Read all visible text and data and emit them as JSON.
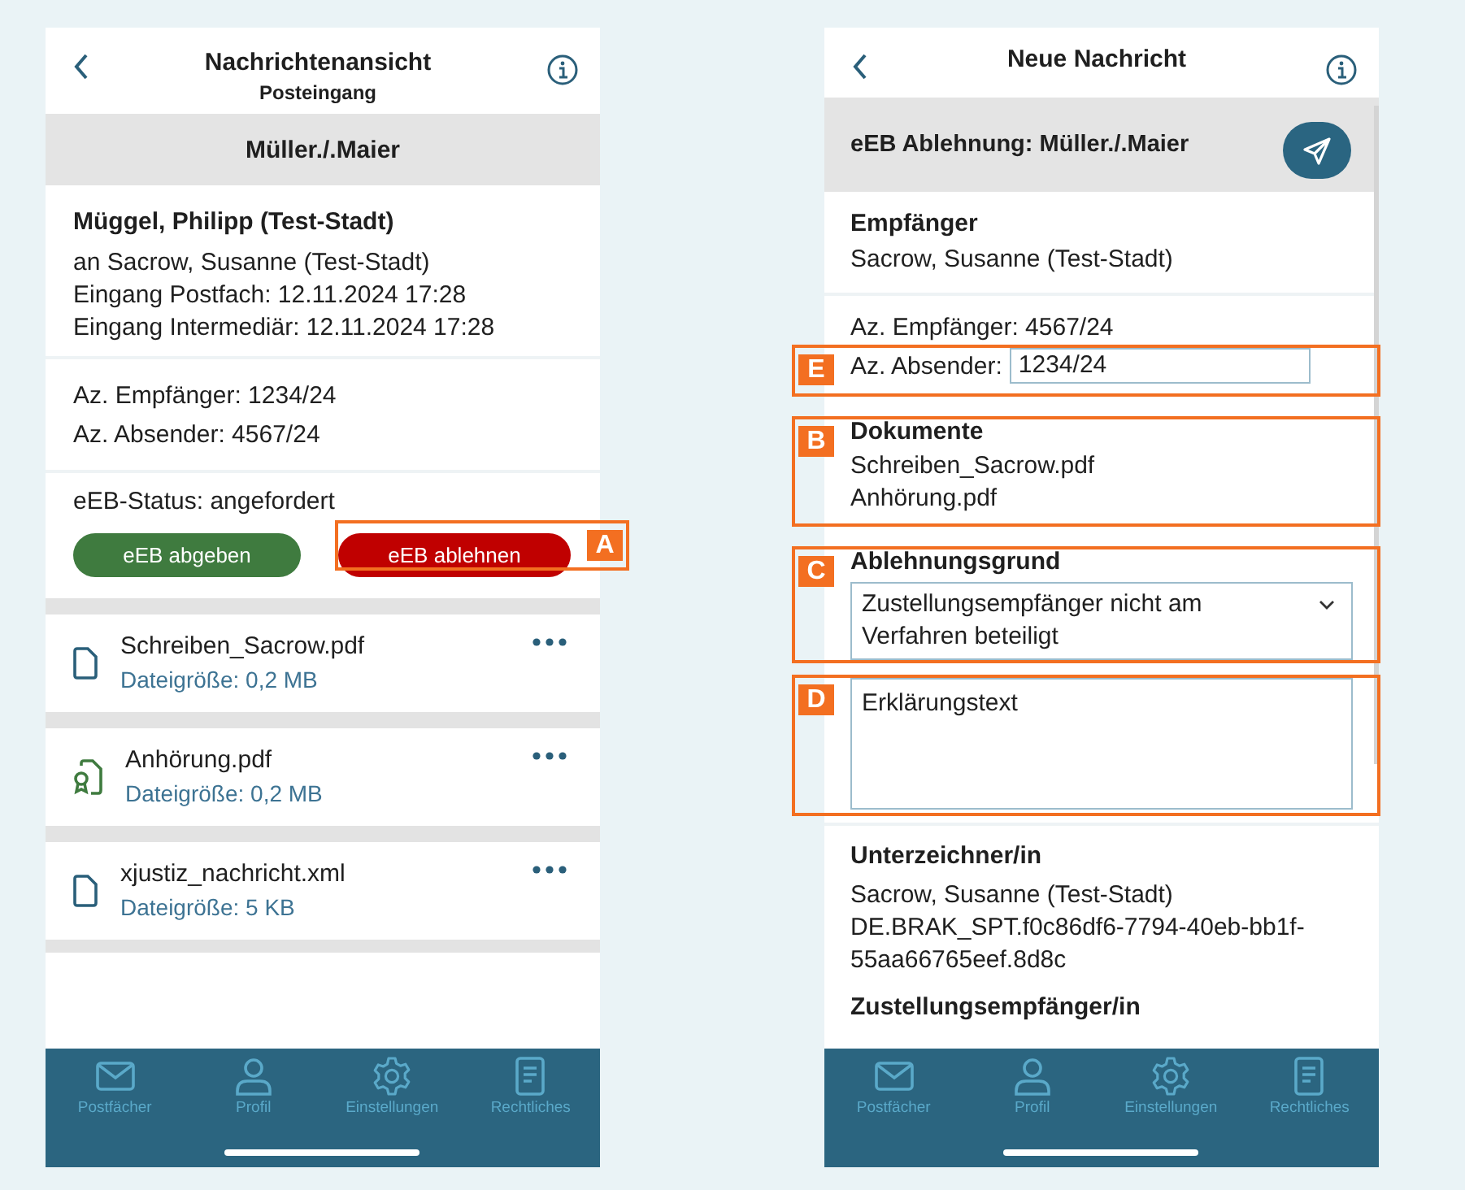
{
  "message_view": {
    "header": {
      "title": "Nachrichtenansicht",
      "subtitle": "Posteingang"
    },
    "case_title": "Müller./.Maier",
    "sender": "Müggel, Philipp (Test-Stadt)",
    "details": [
      "an Sacrow, Susanne (Test-Stadt)",
      "Eingang Postfach: 12.11.2024 17:28",
      "Eingang Intermediär: 12.11.2024 17:28"
    ],
    "references": [
      "Az. Empfänger: 1234/24",
      "Az. Absender: 4567/24"
    ],
    "status": "eEB-Status: angefordert",
    "actions": [
      {
        "label": "eEB abgeben",
        "kind": "accept"
      },
      {
        "label": "eEB ablehnen",
        "kind": "reject"
      }
    ],
    "files": [
      {
        "name": "Schreiben_Sacrow.pdf",
        "size": "Dateigröße: 0,2 MB",
        "kind": "document"
      },
      {
        "name": "Anhörung.pdf",
        "size": "Dateigröße: 0,2 MB",
        "kind": "signed"
      },
      {
        "name": "xjustiz_nachricht.xml",
        "size": "Dateigröße: 5 KB",
        "kind": "document"
      }
    ],
    "tab_bar": [
      {
        "label": "Postfächer"
      },
      {
        "label": "Profil"
      },
      {
        "label": "Einstellungen"
      },
      {
        "label": "Rechtliches"
      }
    ]
  },
  "new_message": {
    "header": {
      "title": "Neue Nachricht"
    },
    "subject": "eEB Ablehnung: Müller./.Maier",
    "recipient": {
      "label": "Empfänger",
      "value": "Sacrow, Susanne (Test-Stadt)"
    },
    "recipient_reference": "Az. Empfänger: 4567/24",
    "sender_reference": {
      "label": "Az. Absender:",
      "value": "1234/24"
    },
    "documents": {
      "label": "Dokumente",
      "items": [
        "Schreiben_Sacrow.pdf",
        "Anhörung.pdf"
      ]
    },
    "rejection_reason": {
      "label": "Ablehnungsgrund",
      "value": "Zustellungsempfänger nicht am Verfahren beteiligt"
    },
    "explanation": {
      "value": "Erklärungstext"
    },
    "signer": {
      "label": "Unterzeichner/in",
      "lines": [
        "Sacrow, Susanne (Test-Stadt)",
        "DE.BRAK_SPT.f0c86df6-7794-40eb-bb1f-55aa66765eef.8d8c"
      ]
    },
    "delivery_recipient": {
      "label": "Zustellungsempfänger/in"
    },
    "tab_bar": [
      {
        "label": "Postfächer"
      },
      {
        "label": "Profil"
      },
      {
        "label": "Einstellungen"
      },
      {
        "label": "Rechtliches"
      }
    ]
  },
  "annotations": [
    {
      "label": "A"
    },
    {
      "label": "E"
    },
    {
      "label": "B"
    },
    {
      "label": "C"
    },
    {
      "label": "D"
    }
  ]
}
